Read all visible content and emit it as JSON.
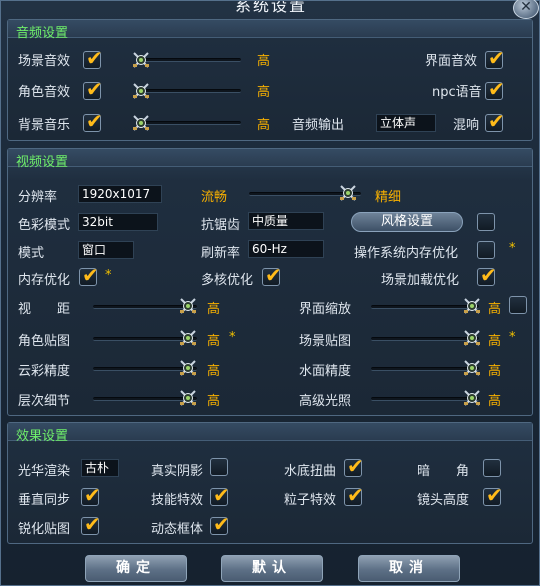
{
  "window": {
    "title": "系统设置",
    "close": "✕"
  },
  "audio": {
    "title": "音频设置",
    "scene_sfx": {
      "label": "场景音效",
      "level": "高",
      "checked": true
    },
    "char_sfx": {
      "label": "角色音效",
      "level": "高",
      "checked": true
    },
    "bg_music": {
      "label": "背景音乐",
      "level": "高",
      "checked": true
    },
    "ui_sfx": {
      "label": "界面音效",
      "checked": true
    },
    "npc_voice": {
      "label": "npc语音",
      "checked": true
    },
    "output": {
      "label": "音频输出",
      "value": "立体声"
    },
    "reverb": {
      "label": "混响",
      "checked": true
    }
  },
  "video": {
    "title": "视频设置",
    "resolution": {
      "label": "分辨率",
      "value": "1920x1017"
    },
    "quality": {
      "low": "流畅",
      "high": "精细"
    },
    "color_mode": {
      "label": "色彩模式",
      "value": "32bit"
    },
    "antialias": {
      "label": "抗锯齿",
      "value": "中质量"
    },
    "style_button": "风格设置",
    "mode": {
      "label": "模式",
      "value": "窗口"
    },
    "refresh": {
      "label": "刷新率",
      "value": "60-Hz"
    },
    "os_memory": {
      "label": "操作系统内存优化",
      "checked": false
    },
    "mem_opt": {
      "label": "内存优化",
      "checked": true
    },
    "multicore": {
      "label": "多核优化",
      "checked": true
    },
    "scene_load": {
      "label": "场景加载优化",
      "checked": true
    },
    "view_dist": {
      "label": "视　　距",
      "level": "高"
    },
    "ui_scale": {
      "label": "界面缩放",
      "level": "高",
      "checked": false
    },
    "char_tex": {
      "label": "角色贴图",
      "level": "高"
    },
    "scene_tex": {
      "label": "场景贴图",
      "level": "高"
    },
    "cloud": {
      "label": "云彩精度",
      "level": "高"
    },
    "water": {
      "label": "水面精度",
      "level": "高"
    },
    "lod": {
      "label": "层次细节",
      "level": "高"
    },
    "lighting": {
      "label": "高级光照",
      "level": "高"
    },
    "star": "*"
  },
  "effects": {
    "title": "效果设置",
    "glow": {
      "label": "光华渲染",
      "value": "古朴"
    },
    "shadow": {
      "label": "真实阴影",
      "checked": false
    },
    "underwater": {
      "label": "水底扭曲",
      "checked": true
    },
    "dark_corner": {
      "label": "暗　　角",
      "checked": false
    },
    "vsync": {
      "label": "垂直同步",
      "checked": true
    },
    "skill_fx": {
      "label": "技能特效",
      "checked": true
    },
    "particle": {
      "label": "粒子特效",
      "checked": true
    },
    "lens_height": {
      "label": "镜头高度",
      "checked": true
    },
    "sharpen": {
      "label": "锐化贴图",
      "checked": true
    },
    "motion_frame": {
      "label": "动态框体",
      "checked": true
    }
  },
  "buttons": {
    "ok": "确定",
    "default": "默认",
    "cancel": "取消"
  },
  "icons": {
    "check": "✔",
    "slider_knob": "crossed-swords-icon"
  },
  "colors": {
    "section_title": "#6ff06a",
    "level": "#f7b000",
    "check": "#ffbb1a"
  }
}
